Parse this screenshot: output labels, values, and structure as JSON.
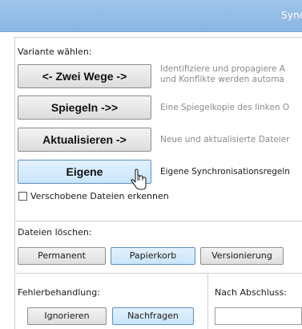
{
  "window": {
    "title": "Sync"
  },
  "variant": {
    "label": "Variante wählen:",
    "options": [
      {
        "button": "<- Zwei Wege ->",
        "description": "Identifiziere und propagiere Ä\nund Konflikte werden automa"
      },
      {
        "button": "Spiegeln ->>",
        "description": "Eine Spiegelkopie des linken O"
      },
      {
        "button": "Aktualisieren ->",
        "description": "Neue und aktualisierte Dateier"
      },
      {
        "button": "Eigene",
        "description": "Eigene Synchronisationsregeln",
        "selected": true
      }
    ],
    "detect_moved": {
      "label": "Verschobene Dateien erkennen",
      "checked": false
    }
  },
  "delete": {
    "label": "Dateien löschen:",
    "options": [
      "Permanent",
      "Papierkorb",
      "Versionierung"
    ],
    "selected": "Papierkorb"
  },
  "errors": {
    "label": "Fehlerbehandlung:",
    "options": [
      "Ignorieren",
      "Nachfragen"
    ],
    "selected": "Nachfragen"
  },
  "after": {
    "label": "Nach Abschluss:",
    "value": ""
  },
  "colors": {
    "titlebar": "#8bb6e3",
    "selected_button": "#c9e6fb",
    "selected_border": "#5f8fc2"
  },
  "icons": {
    "pointer": "mouse-cursor-icon"
  }
}
